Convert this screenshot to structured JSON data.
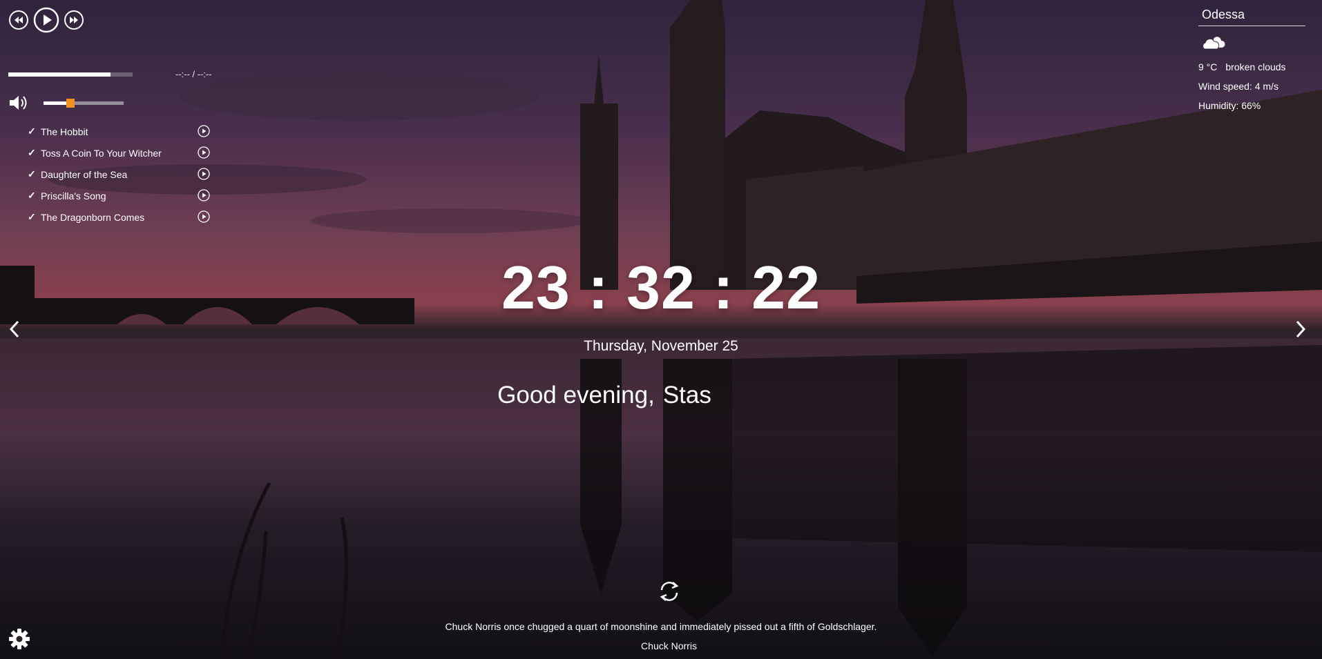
{
  "player": {
    "time": "--:-- / --:--",
    "progress": 0.82,
    "volume": 0.34,
    "playlist": [
      {
        "title": "The Hobbit"
      },
      {
        "title": "Toss A Coin To Your Witcher"
      },
      {
        "title": "Daughter of the Sea"
      },
      {
        "title": "Priscilla's Song"
      },
      {
        "title": "The Dragonborn Comes"
      }
    ],
    "check_glyph": "✓"
  },
  "weather": {
    "city": "Odessa",
    "temperature": "9 °C",
    "description": "broken clouds",
    "wind": "Wind speed: 4 m/s",
    "humidity": "Humidity: 66%",
    "icon": "cloud-icon"
  },
  "clock": {
    "time": "23 : 32 : 22",
    "date": "Thursday, November 25"
  },
  "greeting": {
    "text": "Good evening,",
    "name": "Stas"
  },
  "quote": {
    "text": "Chuck Norris once chugged a quart of moonshine and immediately pissed out a fifth of Goldschlager.",
    "author": "Chuck Norris"
  },
  "colors": {
    "accent": "#f0921e"
  }
}
